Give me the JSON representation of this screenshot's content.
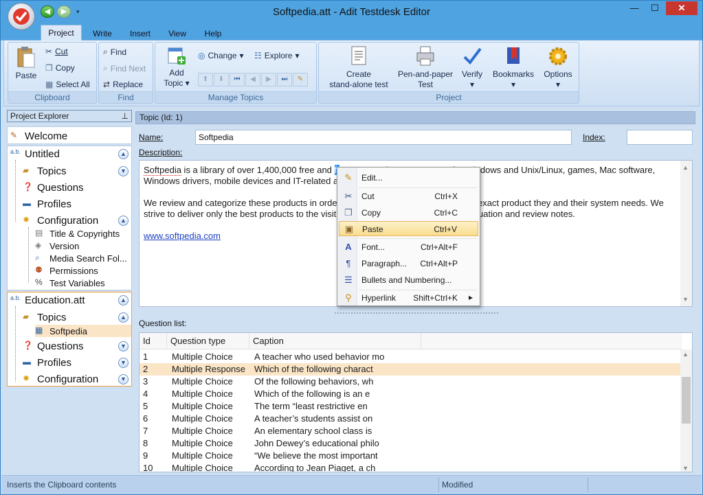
{
  "window": {
    "title": "Softpedia.att - Adit Testdesk Editor",
    "minimize": "—",
    "maximize": "☐",
    "close": "✕"
  },
  "ribbon_tabs": [
    "Project",
    "Write",
    "Insert",
    "View",
    "Help"
  ],
  "clipboard": {
    "paste": "Paste",
    "cut": "Cut",
    "copy": "Copy",
    "select_all": "Select All",
    "label": "Clipboard"
  },
  "find": {
    "find": "Find",
    "find_next": "Find Next",
    "replace": "Replace",
    "label": "Find"
  },
  "manage_topics": {
    "add_topic_1": "Add",
    "add_topic_2": "Topic",
    "change": "Change",
    "explore": "Explore",
    "label": "Manage Topics"
  },
  "project_group": {
    "create_1": "Create",
    "create_2": "stand-alone test",
    "pen_1": "Pen-and-paper",
    "pen_2": "Test",
    "verify": "Verify",
    "bookmarks": "Bookmarks",
    "options": "Options",
    "label": "Project"
  },
  "explorer": {
    "title": "Project Explorer",
    "welcome": "Welcome",
    "untitled": {
      "name": "Untitled",
      "topics": "Topics",
      "questions": "Questions",
      "profiles": "Profiles",
      "configuration": "Configuration",
      "config_items": [
        "Title & Copyrights",
        "Version",
        "Media Search Fol...",
        "Permissions",
        "Test Variables"
      ]
    },
    "education": {
      "name": "Education.att",
      "topics": "Topics",
      "topic_item": "Softpedia",
      "questions": "Questions",
      "profiles": "Profiles",
      "configuration": "Configuration"
    }
  },
  "topic": {
    "header": "Topic (Id: 1)",
    "name_label": "Name:",
    "name_value": "Softpedia",
    "index_label": "Index:",
    "index_value": "",
    "description_label": "Description:",
    "desc_line1a": "Softpedia",
    "desc_line1b": " is a library of over 1,400,000 free and ",
    "desc_line1c": "fr",
    "desc_line1d": "ee-to-try software programs for Windows and Unix/Linux, games, Mac software,",
    "desc_line2": "Windows drivers, mobile devices and IT-related articles.",
    "desc_para2": "We review and categorize these products in order to allow the visitor/user to find the exact product they and their system needs. We strive to deliver only the best products to the visitor/user together with self-made evaluation and review notes.",
    "desc_link": "www.softpedia.com"
  },
  "question_list": {
    "label": "Question list:",
    "columns": [
      "Id",
      "Question type",
      "Caption"
    ],
    "rows": [
      {
        "id": "1",
        "type": "Multiple Choice",
        "caption": "A teacher who used behavior mo"
      },
      {
        "id": "2",
        "type": "Multiple Response",
        "caption": "Which of the following charact"
      },
      {
        "id": "3",
        "type": "Multiple Choice",
        "caption": "Of the following behaviors, wh"
      },
      {
        "id": "4",
        "type": "Multiple Choice",
        "caption": "Which of the following is an e"
      },
      {
        "id": "5",
        "type": "Multiple Choice",
        "caption": "The term “least restrictive en"
      },
      {
        "id": "6",
        "type": "Multiple Choice",
        "caption": "A teacher’s students assist on"
      },
      {
        "id": "7",
        "type": "Multiple Choice",
        "caption": "An elementary school class is"
      },
      {
        "id": "8",
        "type": "Multiple Choice",
        "caption": "John Dewey’s educational philo"
      },
      {
        "id": "9",
        "type": "Multiple Choice",
        "caption": "“We believe the most important"
      },
      {
        "id": "10",
        "type": "Multiple Choice",
        "caption": "According to Jean Piaget, a ch"
      }
    ]
  },
  "context_menu": {
    "edit": "Edit...",
    "cut": "Cut",
    "cut_sc": "Ctrl+X",
    "copy": "Copy",
    "copy_sc": "Ctrl+C",
    "paste": "Paste",
    "paste_sc": "Ctrl+V",
    "font": "Font...",
    "font_sc": "Ctrl+Alt+F",
    "paragraph": "Paragraph...",
    "paragraph_sc": "Ctrl+Alt+P",
    "bullets": "Bullets and Numbering...",
    "hyperlink": "Hyperlink",
    "hyperlink_sc": "Shift+Ctrl+K"
  },
  "status": {
    "hint": "Inserts the Clipboard contents",
    "state": "Modified"
  },
  "colors": {
    "title_bar": "#4fa3e0",
    "ribbon_bg": "#dbe8f7",
    "selected_row": "#fbe5c7",
    "close_button": "#c7372f"
  }
}
